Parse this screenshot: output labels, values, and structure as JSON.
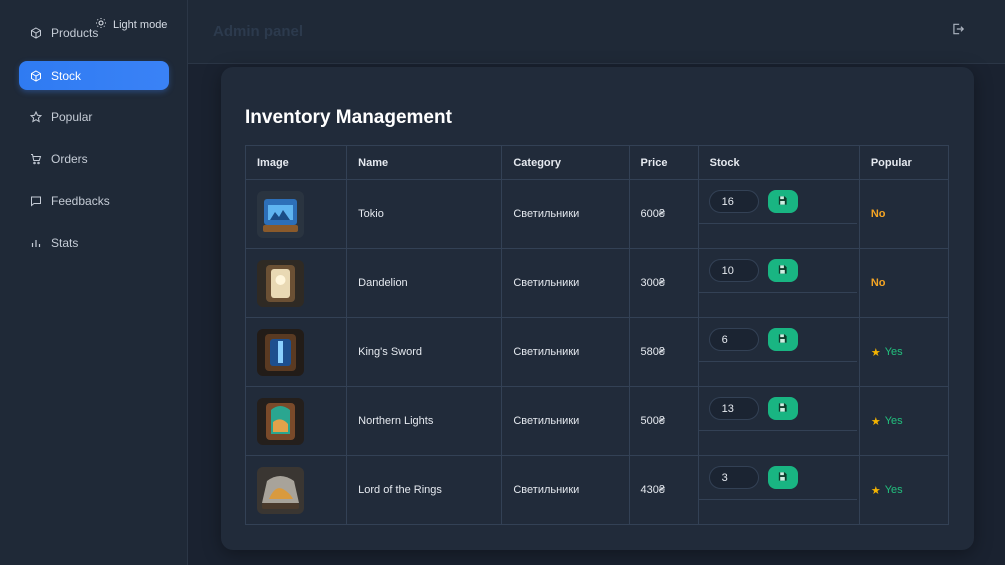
{
  "sidebar": {
    "theme_toggle_label": "Light mode",
    "items": [
      {
        "label": "Products",
        "icon": "box-icon"
      },
      {
        "label": "Stock",
        "icon": "box-icon",
        "active": true
      },
      {
        "label": "Popular",
        "icon": "star-icon"
      },
      {
        "label": "Orders",
        "icon": "cart-icon"
      },
      {
        "label": "Feedbacks",
        "icon": "chat-icon"
      },
      {
        "label": "Stats",
        "icon": "bar-chart-icon"
      }
    ]
  },
  "header": {
    "title": "Admin panel"
  },
  "main": {
    "title": "Inventory Management",
    "columns": [
      "Image",
      "Name",
      "Category",
      "Price",
      "Stock",
      "Popular"
    ],
    "rows": [
      {
        "name": "Tokio",
        "category": "Светильники",
        "price": "600₴",
        "stock": "16",
        "popular": "No"
      },
      {
        "name": "Dandelion",
        "category": "Светильники",
        "price": "300₴",
        "stock": "10",
        "popular": "No"
      },
      {
        "name": "King's Sword",
        "category": "Светильники",
        "price": "580₴",
        "stock": "6",
        "popular": "Yes"
      },
      {
        "name": "Northern Lights",
        "category": "Светильники",
        "price": "500₴",
        "stock": "13",
        "popular": "Yes"
      },
      {
        "name": "Lord of the Rings",
        "category": "Светильники",
        "price": "430₴",
        "stock": "3",
        "popular": "Yes"
      }
    ]
  },
  "colors": {
    "accent": "#3a82f6",
    "save_button": "#19b582",
    "popular_no": "#f5a524",
    "popular_yes": "#22c07e"
  }
}
